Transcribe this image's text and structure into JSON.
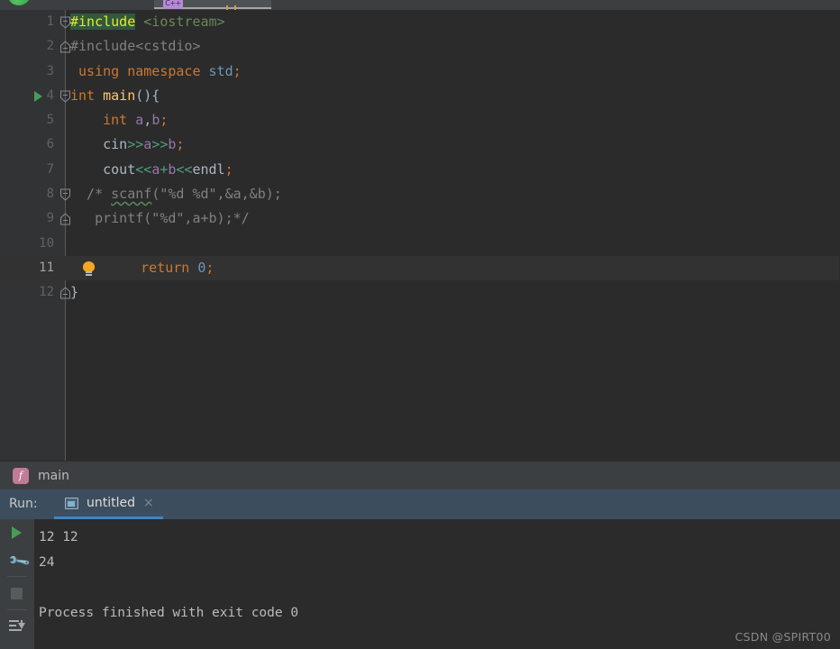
{
  "window": {
    "theme_bg": "#2b2b2b",
    "gutter_bg": "#313335",
    "accent": "#3d86c7",
    "run_green": "#499c54"
  },
  "topbar": {
    "logo_icon": "clion-logo-icon",
    "tab_icon": "cpp-file-icon",
    "tab_icon_label": "C++"
  },
  "editor": {
    "lines": [
      {
        "number": "1",
        "fold": "collapse-start",
        "run_marker": false,
        "bulb": false,
        "caret": false,
        "tokens": [
          {
            "cls": "hl",
            "text": "#include"
          },
          {
            "cls": "plain",
            "text": " "
          },
          {
            "cls": "incl",
            "text": "<iostream>"
          }
        ]
      },
      {
        "number": "2",
        "fold": "collapse-end",
        "run_marker": false,
        "bulb": false,
        "caret": false,
        "tokens": [
          {
            "cls": "gray",
            "text": "#include<cstdio>"
          }
        ]
      },
      {
        "number": "3",
        "fold": "none",
        "run_marker": false,
        "bulb": false,
        "caret": false,
        "tokens": [
          {
            "cls": "plain",
            "text": " "
          },
          {
            "cls": "kw",
            "text": "using namespace"
          },
          {
            "cls": "plain",
            "text": " "
          },
          {
            "cls": "num",
            "text": "std"
          },
          {
            "cls": "kw",
            "text": ";"
          }
        ]
      },
      {
        "number": "4",
        "fold": "collapse-start",
        "run_marker": true,
        "bulb": false,
        "caret": false,
        "tokens": [
          {
            "cls": "kw",
            "text": "int"
          },
          {
            "cls": "plain",
            "text": " "
          },
          {
            "cls": "fn",
            "text": "main"
          },
          {
            "cls": "plain",
            "text": "(){"
          }
        ]
      },
      {
        "number": "5",
        "fold": "none",
        "run_marker": false,
        "bulb": false,
        "caret": false,
        "tokens": [
          {
            "cls": "plain",
            "text": "    "
          },
          {
            "cls": "kw",
            "text": "int"
          },
          {
            "cls": "plain",
            "text": " "
          },
          {
            "cls": "id",
            "text": "a"
          },
          {
            "cls": "plain",
            "text": ","
          },
          {
            "cls": "id",
            "text": "b"
          },
          {
            "cls": "kw",
            "text": ";"
          }
        ]
      },
      {
        "number": "6",
        "fold": "none",
        "run_marker": false,
        "bulb": false,
        "caret": false,
        "tokens": [
          {
            "cls": "plain",
            "text": "    cin"
          },
          {
            "cls": "op",
            "text": ">>"
          },
          {
            "cls": "id",
            "text": "a"
          },
          {
            "cls": "op",
            "text": ">>"
          },
          {
            "cls": "id",
            "text": "b"
          },
          {
            "cls": "kw",
            "text": ";"
          }
        ]
      },
      {
        "number": "7",
        "fold": "none",
        "run_marker": false,
        "bulb": false,
        "caret": false,
        "tokens": [
          {
            "cls": "plain",
            "text": "    cout"
          },
          {
            "cls": "op",
            "text": "<<"
          },
          {
            "cls": "id",
            "text": "a"
          },
          {
            "cls": "op",
            "text": "+"
          },
          {
            "cls": "id",
            "text": "b"
          },
          {
            "cls": "op",
            "text": "<<"
          },
          {
            "cls": "plain",
            "text": "endl"
          },
          {
            "cls": "kw",
            "text": ";"
          }
        ]
      },
      {
        "number": "8",
        "fold": "collapse-start",
        "run_marker": false,
        "bulb": false,
        "caret": false,
        "tokens": [
          {
            "cls": "cmt",
            "text": "  /* "
          },
          {
            "cls": "cmt typo",
            "text": "scanf"
          },
          {
            "cls": "cmt",
            "text": "(\"%d %d\",&a,&b);"
          }
        ]
      },
      {
        "number": "9",
        "fold": "collapse-end",
        "run_marker": false,
        "bulb": false,
        "caret": false,
        "tokens": [
          {
            "cls": "cmt",
            "text": "   printf(\"%d\",a+b);*/"
          }
        ]
      },
      {
        "number": "10",
        "fold": "none",
        "run_marker": false,
        "bulb": false,
        "caret": false,
        "tokens": []
      },
      {
        "number": "11",
        "fold": "none",
        "run_marker": false,
        "bulb": true,
        "caret": true,
        "tokens": [
          {
            "cls": "plain",
            "text": "    "
          },
          {
            "cls": "kw",
            "text": "return"
          },
          {
            "cls": "plain",
            "text": " "
          },
          {
            "cls": "num",
            "text": "0"
          },
          {
            "cls": "kw",
            "text": ";"
          }
        ]
      },
      {
        "number": "12",
        "fold": "collapse-end",
        "run_marker": false,
        "bulb": false,
        "caret": false,
        "tokens": [
          {
            "cls": "plain",
            "text": "}"
          }
        ]
      }
    ]
  },
  "breadcrumb": {
    "icon": "function-icon",
    "icon_letter": "f",
    "label": "main"
  },
  "run_panel": {
    "label": "Run:",
    "tab": {
      "icon": "console-window-icon",
      "label": "untitled",
      "close": "×"
    },
    "tools": [
      {
        "name": "rerun-button",
        "icon": "play-icon"
      },
      {
        "name": "run-configuration-button",
        "icon": "wrench-icon"
      },
      {
        "name": "stop-button",
        "icon": "stop-square-icon"
      },
      {
        "name": "scroll-to-end-button",
        "icon": "scroll-to-end-icon"
      }
    ],
    "console_lines": [
      "12 12",
      "24",
      "",
      "Process finished with exit code 0"
    ]
  },
  "watermark": "CSDN @SPIRT00"
}
